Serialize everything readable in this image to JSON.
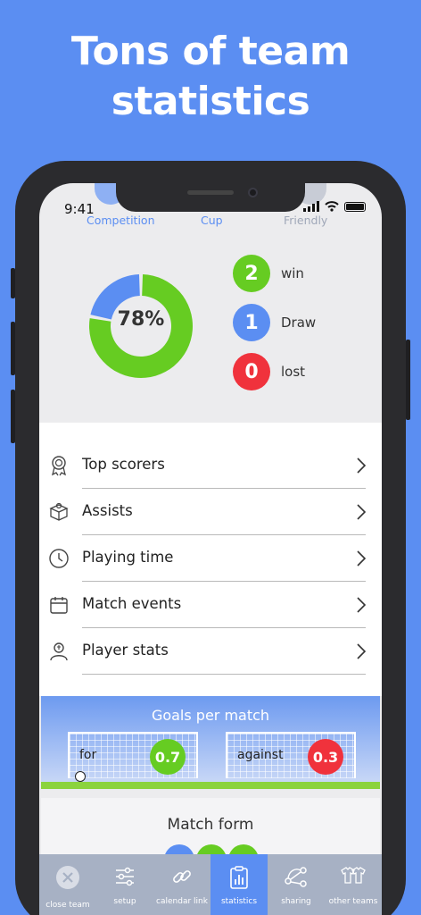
{
  "headline": {
    "line1": "Tons of team",
    "line2": "statistics"
  },
  "status_bar": {
    "time": "9:41"
  },
  "segments": [
    {
      "label": "Competition",
      "color": "#5b8ef2"
    },
    {
      "label": "Cup",
      "color": "#5b8ef2"
    },
    {
      "label": "Friendly",
      "color": "#9fa7b8"
    }
  ],
  "summary": {
    "percent_label": "78%",
    "win_fraction": 0.78,
    "results": [
      {
        "count": "2",
        "label": "win",
        "color": "#66cc22"
      },
      {
        "count": "1",
        "label": "Draw",
        "color": "#5b8ef2"
      },
      {
        "count": "0",
        "label": "lost",
        "color": "#f0323c"
      }
    ]
  },
  "menu": [
    {
      "label": "Top scorers",
      "icon": "medal-icon"
    },
    {
      "label": "Assists",
      "icon": "gift-box-icon"
    },
    {
      "label": "Playing time",
      "icon": "clock-icon"
    },
    {
      "label": "Match events",
      "icon": "calendar-icon"
    },
    {
      "label": "Player stats",
      "icon": "player-icon"
    }
  ],
  "goals": {
    "title": "Goals per match",
    "for_label": "for",
    "for_value": "0.7",
    "against_label": "against",
    "against_value": "0.3"
  },
  "match_form": {
    "title": "Match form"
  },
  "tabbar": [
    {
      "label": "close team",
      "icon": "close-circle-icon"
    },
    {
      "label": "setup",
      "icon": "sliders-icon"
    },
    {
      "label": "calendar link",
      "icon": "link-icon"
    },
    {
      "label": "statistics",
      "icon": "clipboard-chart-icon"
    },
    {
      "label": "sharing",
      "icon": "share-nodes-icon"
    },
    {
      "label": "other teams",
      "icon": "jerseys-icon"
    }
  ],
  "colors": {
    "accent": "#5b8ef2",
    "win": "#66cc22",
    "loss": "#f0323c"
  }
}
